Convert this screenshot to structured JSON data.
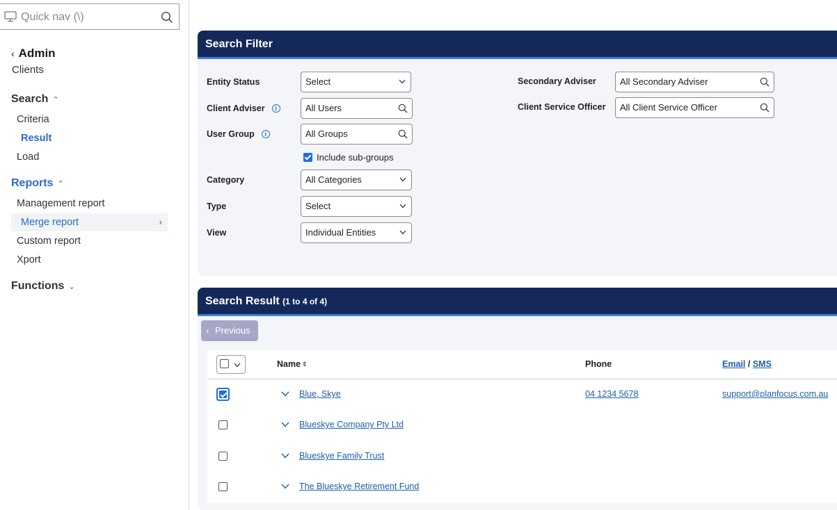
{
  "sidebar": {
    "quick_nav": {
      "placeholder": "Quick nav (\\)"
    },
    "back": {
      "title": "Admin"
    },
    "subtitle": "Clients",
    "search": {
      "label": "Search",
      "items": [
        "Criteria",
        "Result",
        "Load"
      ]
    },
    "reports": {
      "label": "Reports",
      "items": [
        "Management report",
        "Merge report",
        "Custom report",
        "Xport"
      ]
    },
    "functions": {
      "label": "Functions"
    }
  },
  "filter": {
    "title": "Search Filter",
    "fields": {
      "entity_status": {
        "label": "Entity Status",
        "value": "Select"
      },
      "client_adviser": {
        "label": "Client Adviser",
        "value": "All Users"
      },
      "user_group": {
        "label": "User Group",
        "value": "All Groups"
      },
      "include_subgroups": {
        "label": "Include sub-groups",
        "checked": true
      },
      "category": {
        "label": "Category",
        "value": "All Categories"
      },
      "type": {
        "label": "Type",
        "value": "Select"
      },
      "view": {
        "label": "View",
        "value": "Individual Entities"
      },
      "secondary_adviser": {
        "label": "Secondary Adviser",
        "value": "All Secondary Adviser"
      },
      "client_service_officer": {
        "label": "Client Service Officer",
        "value": "All Client Service Officer"
      }
    }
  },
  "results": {
    "title": "Search Result",
    "count": "(1 to 4 of 4)",
    "previous_label": "Previous",
    "columns": {
      "name": "Name",
      "phone": "Phone",
      "email": "Email",
      "sep": "/",
      "sms": "SMS"
    },
    "rows": [
      {
        "name": "Blue, Skye",
        "phone": "04 1234 5678",
        "email": "support@planfocus.com.au",
        "checked": true
      },
      {
        "name": "Blueskye Company Pty Ltd",
        "phone": "",
        "email": "",
        "checked": false
      },
      {
        "name": "Blueskye Family Trust",
        "phone": "",
        "email": "",
        "checked": false
      },
      {
        "name": "The Blueskye Retirement Fund",
        "phone": "",
        "email": "",
        "checked": false
      }
    ]
  },
  "colors": {
    "header": "#14295a",
    "accent": "#3b7fd4",
    "link": "#1e5fa8",
    "nav_active": "#2a6cc4"
  }
}
